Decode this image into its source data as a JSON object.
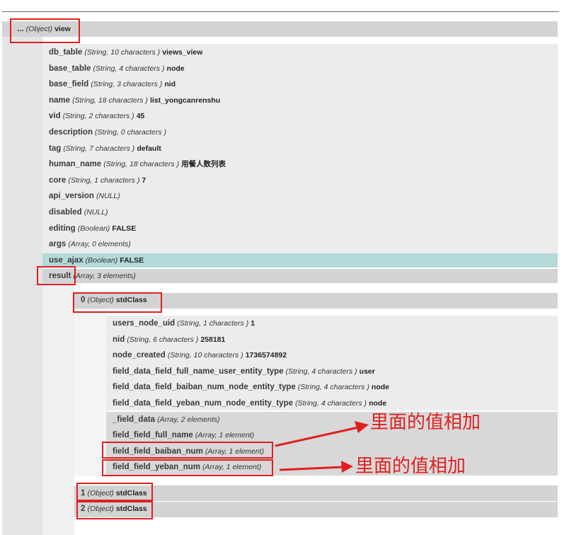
{
  "root": {
    "key": "...",
    "type": "(Object)",
    "value": "view"
  },
  "view_fields": [
    {
      "key": "db_table",
      "type": "(String, 10 characters )",
      "value": "views_view"
    },
    {
      "key": "base_table",
      "type": "(String, 4 characters )",
      "value": "node"
    },
    {
      "key": "base_field",
      "type": "(String, 3 characters )",
      "value": "nid"
    },
    {
      "key": "name",
      "type": "(String, 18 characters )",
      "value": "list_yongcanrenshu"
    },
    {
      "key": "vid",
      "type": "(String, 2 characters )",
      "value": "45"
    },
    {
      "key": "description",
      "type": "(String, 0 characters )",
      "value": ""
    },
    {
      "key": "tag",
      "type": "(String, 7 characters )",
      "value": "default"
    },
    {
      "key": "human_name",
      "type": "(String, 18 characters )",
      "value": "用餐人数列表"
    },
    {
      "key": "core",
      "type": "(String, 1 characters )",
      "value": "7"
    },
    {
      "key": "api_version",
      "type": "(NULL)",
      "value": ""
    },
    {
      "key": "disabled",
      "type": "(NULL)",
      "value": ""
    },
    {
      "key": "editing",
      "type": "(Boolean)",
      "value": "FALSE"
    },
    {
      "key": "args",
      "type": "(Array, 0 elements)",
      "value": ""
    },
    {
      "key": "use_ajax",
      "type": "(Boolean)",
      "value": "FALSE"
    }
  ],
  "result": {
    "key": "result",
    "type": "(Array, 3 elements)",
    "value": ""
  },
  "result_items": [
    {
      "key": "0",
      "type": "(Object)",
      "value": "stdClass"
    },
    {
      "key": "1",
      "type": "(Object)",
      "value": "stdClass"
    },
    {
      "key": "2",
      "type": "(Object)",
      "value": "stdClass"
    }
  ],
  "item0_fields": [
    {
      "key": "users_node_uid",
      "type": "(String, 1 characters )",
      "value": "1"
    },
    {
      "key": "nid",
      "type": "(String, 6 characters )",
      "value": "258181"
    },
    {
      "key": "node_created",
      "type": "(String, 10 characters )",
      "value": "1736574892"
    },
    {
      "key": "field_data_field_full_name_user_entity_type",
      "type": "(String, 4 characters )",
      "value": "user"
    },
    {
      "key": "field_data_field_baiban_num_node_entity_type",
      "type": "(String, 4 characters )",
      "value": "node"
    },
    {
      "key": "field_data_field_yeban_num_node_entity_type",
      "type": "(String, 4 characters )",
      "value": "node"
    },
    {
      "key": "_field_data",
      "type": "(Array, 2 elements)",
      "value": ""
    },
    {
      "key": "field_field_full_name",
      "type": "(Array, 1 element)",
      "value": ""
    },
    {
      "key": "field_field_baiban_num",
      "type": "(Array, 1 element)",
      "value": ""
    },
    {
      "key": "field_field_yeban_num",
      "type": "(Array, 1 element)",
      "value": ""
    }
  ],
  "annotations": [
    "里面的值相加",
    "里面的值相加"
  ],
  "colors": {
    "annotation_red": "#e02020",
    "highlight_row": "#b4dada",
    "band_grey": "#d4d4d4",
    "row_grey": "#eaeaea"
  }
}
